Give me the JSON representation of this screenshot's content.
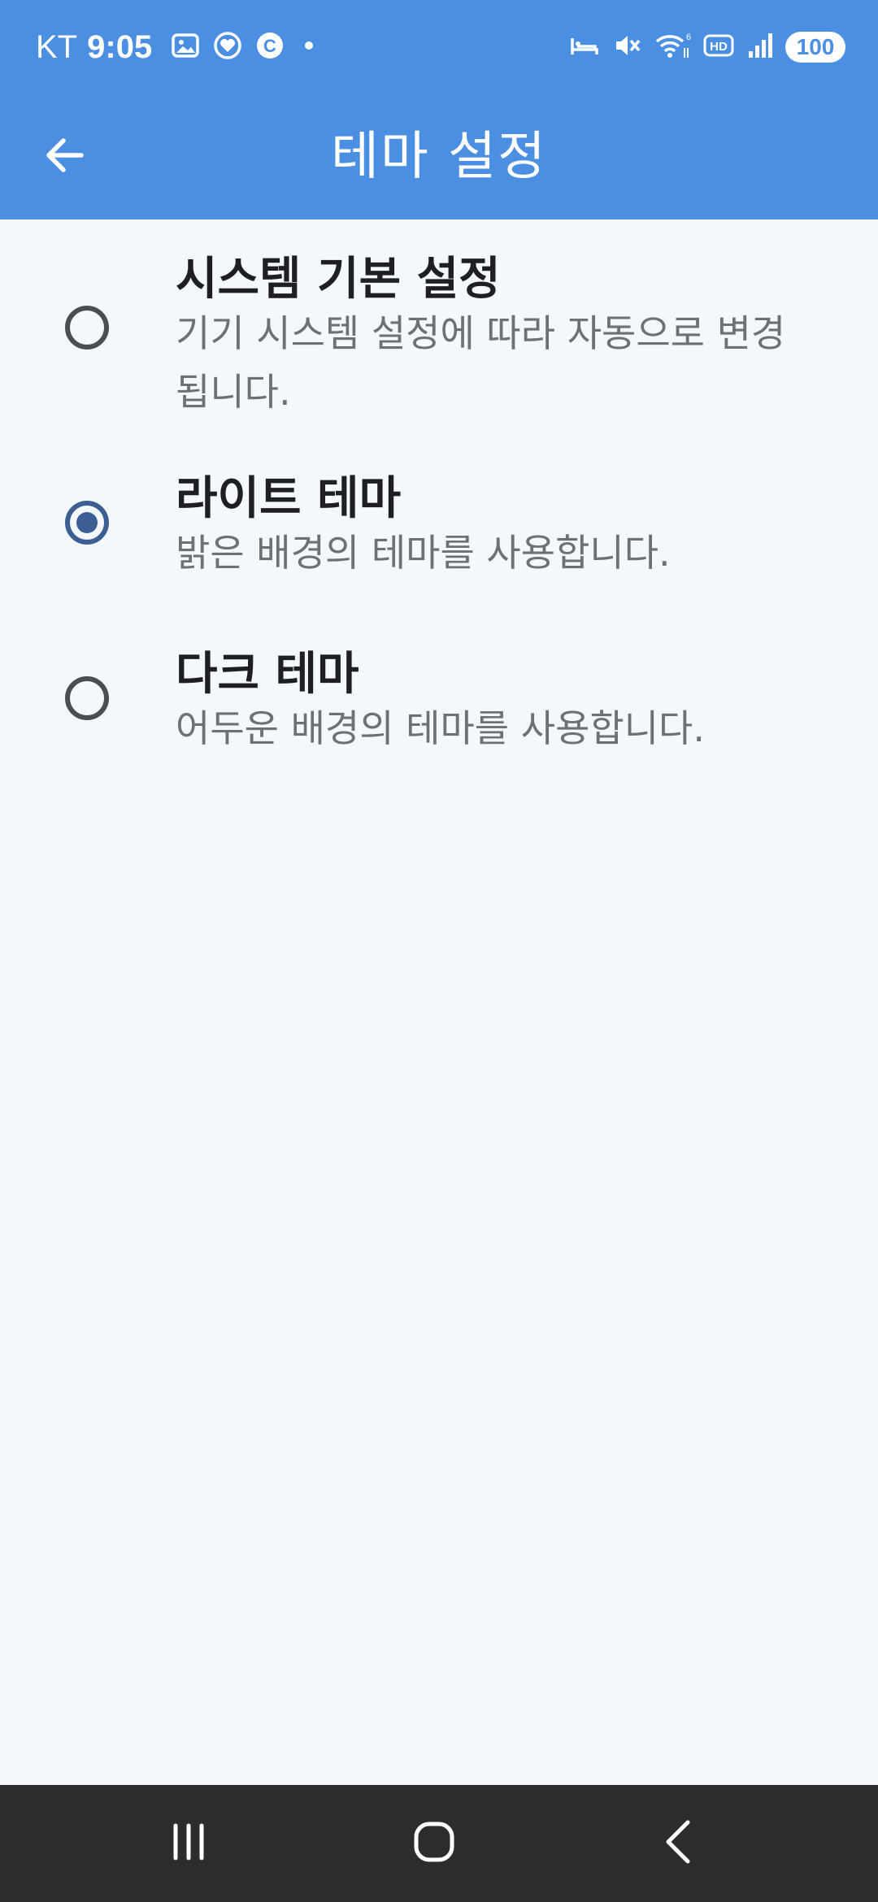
{
  "status_bar": {
    "carrier": "KT",
    "time": "9:05",
    "battery": "100",
    "left_icons": [
      "gallery-notification-icon",
      "heart-notification-icon",
      "c-app-icon",
      "dot-icon"
    ],
    "right_icons": [
      "sleep-mode-icon",
      "mute-icon",
      "wifi-6-icon",
      "hd-voice-icon",
      "signal-icon",
      "battery-icon"
    ]
  },
  "app_bar": {
    "title": "테마 설정",
    "back_icon": "arrow-left-icon"
  },
  "options": [
    {
      "title": "시스템 기본 설정",
      "description": "기기 시스템 설정에 따라 자동으로 변경 됩니다.",
      "selected": false
    },
    {
      "title": "라이트 테마",
      "description": "밝은 배경의 테마를 사용합니다.",
      "selected": true
    },
    {
      "title": "다크 테마",
      "description": "어두운 배경의 테마를 사용합니다.",
      "selected": false
    }
  ],
  "nav_bar": {
    "buttons": [
      "recent-apps-icon",
      "home-icon",
      "back-icon"
    ]
  },
  "colors": {
    "accent": "#4a8fe2",
    "background": "#f4f7fb",
    "radio_selected": "#3b5f94",
    "nav_bar": "#2d2d2f"
  }
}
